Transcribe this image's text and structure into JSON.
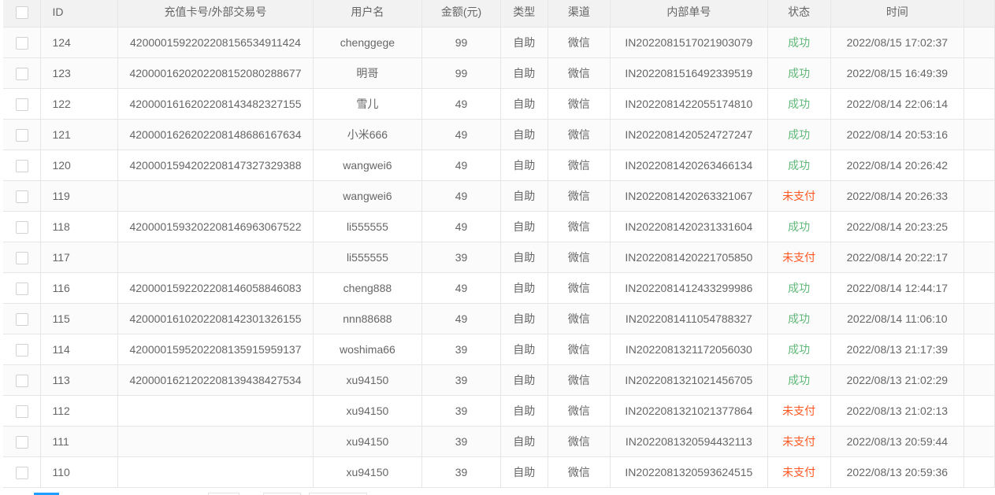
{
  "table": {
    "columns": [
      "ID",
      "充值卡号/外部交易号",
      "用户名",
      "金额(元)",
      "类型",
      "渠道",
      "内部单号",
      "状态",
      "时间"
    ],
    "rows": [
      {
        "id": "124",
        "ext": "4200001592202208156534911424",
        "user": "chenggege",
        "amount": "99",
        "type": "自助",
        "channel": "微信",
        "order": "IN2022081517021903079",
        "status": "成功",
        "time": "2022/08/15 17:02:37"
      },
      {
        "id": "123",
        "ext": "4200001620202208152080288677",
        "user": "明哥",
        "amount": "99",
        "type": "自助",
        "channel": "微信",
        "order": "IN2022081516492339519",
        "status": "成功",
        "time": "2022/08/15 16:49:39"
      },
      {
        "id": "122",
        "ext": "4200001616202208143482327155",
        "user": "雪儿",
        "amount": "49",
        "type": "自助",
        "channel": "微信",
        "order": "IN2022081422055174810",
        "status": "成功",
        "time": "2022/08/14 22:06:14"
      },
      {
        "id": "121",
        "ext": "4200001626202208148686167634",
        "user": "小米666",
        "amount": "49",
        "type": "自助",
        "channel": "微信",
        "order": "IN2022081420524727247",
        "status": "成功",
        "time": "2022/08/14 20:53:16"
      },
      {
        "id": "120",
        "ext": "4200001594202208147327329388",
        "user": "wangwei6",
        "amount": "49",
        "type": "自助",
        "channel": "微信",
        "order": "IN2022081420263466134",
        "status": "成功",
        "time": "2022/08/14 20:26:42"
      },
      {
        "id": "119",
        "ext": "",
        "user": "wangwei6",
        "amount": "49",
        "type": "自助",
        "channel": "微信",
        "order": "IN2022081420263321067",
        "status": "未支付",
        "time": "2022/08/14 20:26:33"
      },
      {
        "id": "118",
        "ext": "4200001593202208146963067522",
        "user": "li555555",
        "amount": "49",
        "type": "自助",
        "channel": "微信",
        "order": "IN2022081420231331604",
        "status": "成功",
        "time": "2022/08/14 20:23:25"
      },
      {
        "id": "117",
        "ext": "",
        "user": "li555555",
        "amount": "39",
        "type": "自助",
        "channel": "微信",
        "order": "IN2022081420221705850",
        "status": "未支付",
        "time": "2022/08/14 20:22:17"
      },
      {
        "id": "116",
        "ext": "4200001592202208146058846083",
        "user": "cheng888",
        "amount": "49",
        "type": "自助",
        "channel": "微信",
        "order": "IN2022081412433299986",
        "status": "成功",
        "time": "2022/08/14 12:44:17"
      },
      {
        "id": "115",
        "ext": "4200001610202208142301326155",
        "user": "nnn88688",
        "amount": "49",
        "type": "自助",
        "channel": "微信",
        "order": "IN2022081411054788327",
        "status": "成功",
        "time": "2022/08/14 11:06:10"
      },
      {
        "id": "114",
        "ext": "4200001595202208135915959137",
        "user": "woshima66",
        "amount": "39",
        "type": "自助",
        "channel": "微信",
        "order": "IN2022081321172056030",
        "status": "成功",
        "time": "2022/08/13 21:17:39"
      },
      {
        "id": "113",
        "ext": "4200001621202208139438427534",
        "user": "xu94150",
        "amount": "39",
        "type": "自助",
        "channel": "微信",
        "order": "IN2022081321021456705",
        "status": "成功",
        "time": "2022/08/13 21:02:29"
      },
      {
        "id": "112",
        "ext": "",
        "user": "xu94150",
        "amount": "39",
        "type": "自助",
        "channel": "微信",
        "order": "IN2022081321021377864",
        "status": "未支付",
        "time": "2022/08/13 21:02:13"
      },
      {
        "id": "111",
        "ext": "",
        "user": "xu94150",
        "amount": "39",
        "type": "自助",
        "channel": "微信",
        "order": "IN2022081320594432113",
        "status": "未支付",
        "time": "2022/08/13 20:59:44"
      },
      {
        "id": "110",
        "ext": "",
        "user": "xu94150",
        "amount": "39",
        "type": "自助",
        "channel": "微信",
        "order": "IN2022081320593624515",
        "status": "未支付",
        "time": "2022/08/13 20:59:36"
      }
    ]
  },
  "colors": {
    "success": "#5fb878",
    "unpaid": "#ff5722",
    "pager_current": "#1e9fff"
  }
}
